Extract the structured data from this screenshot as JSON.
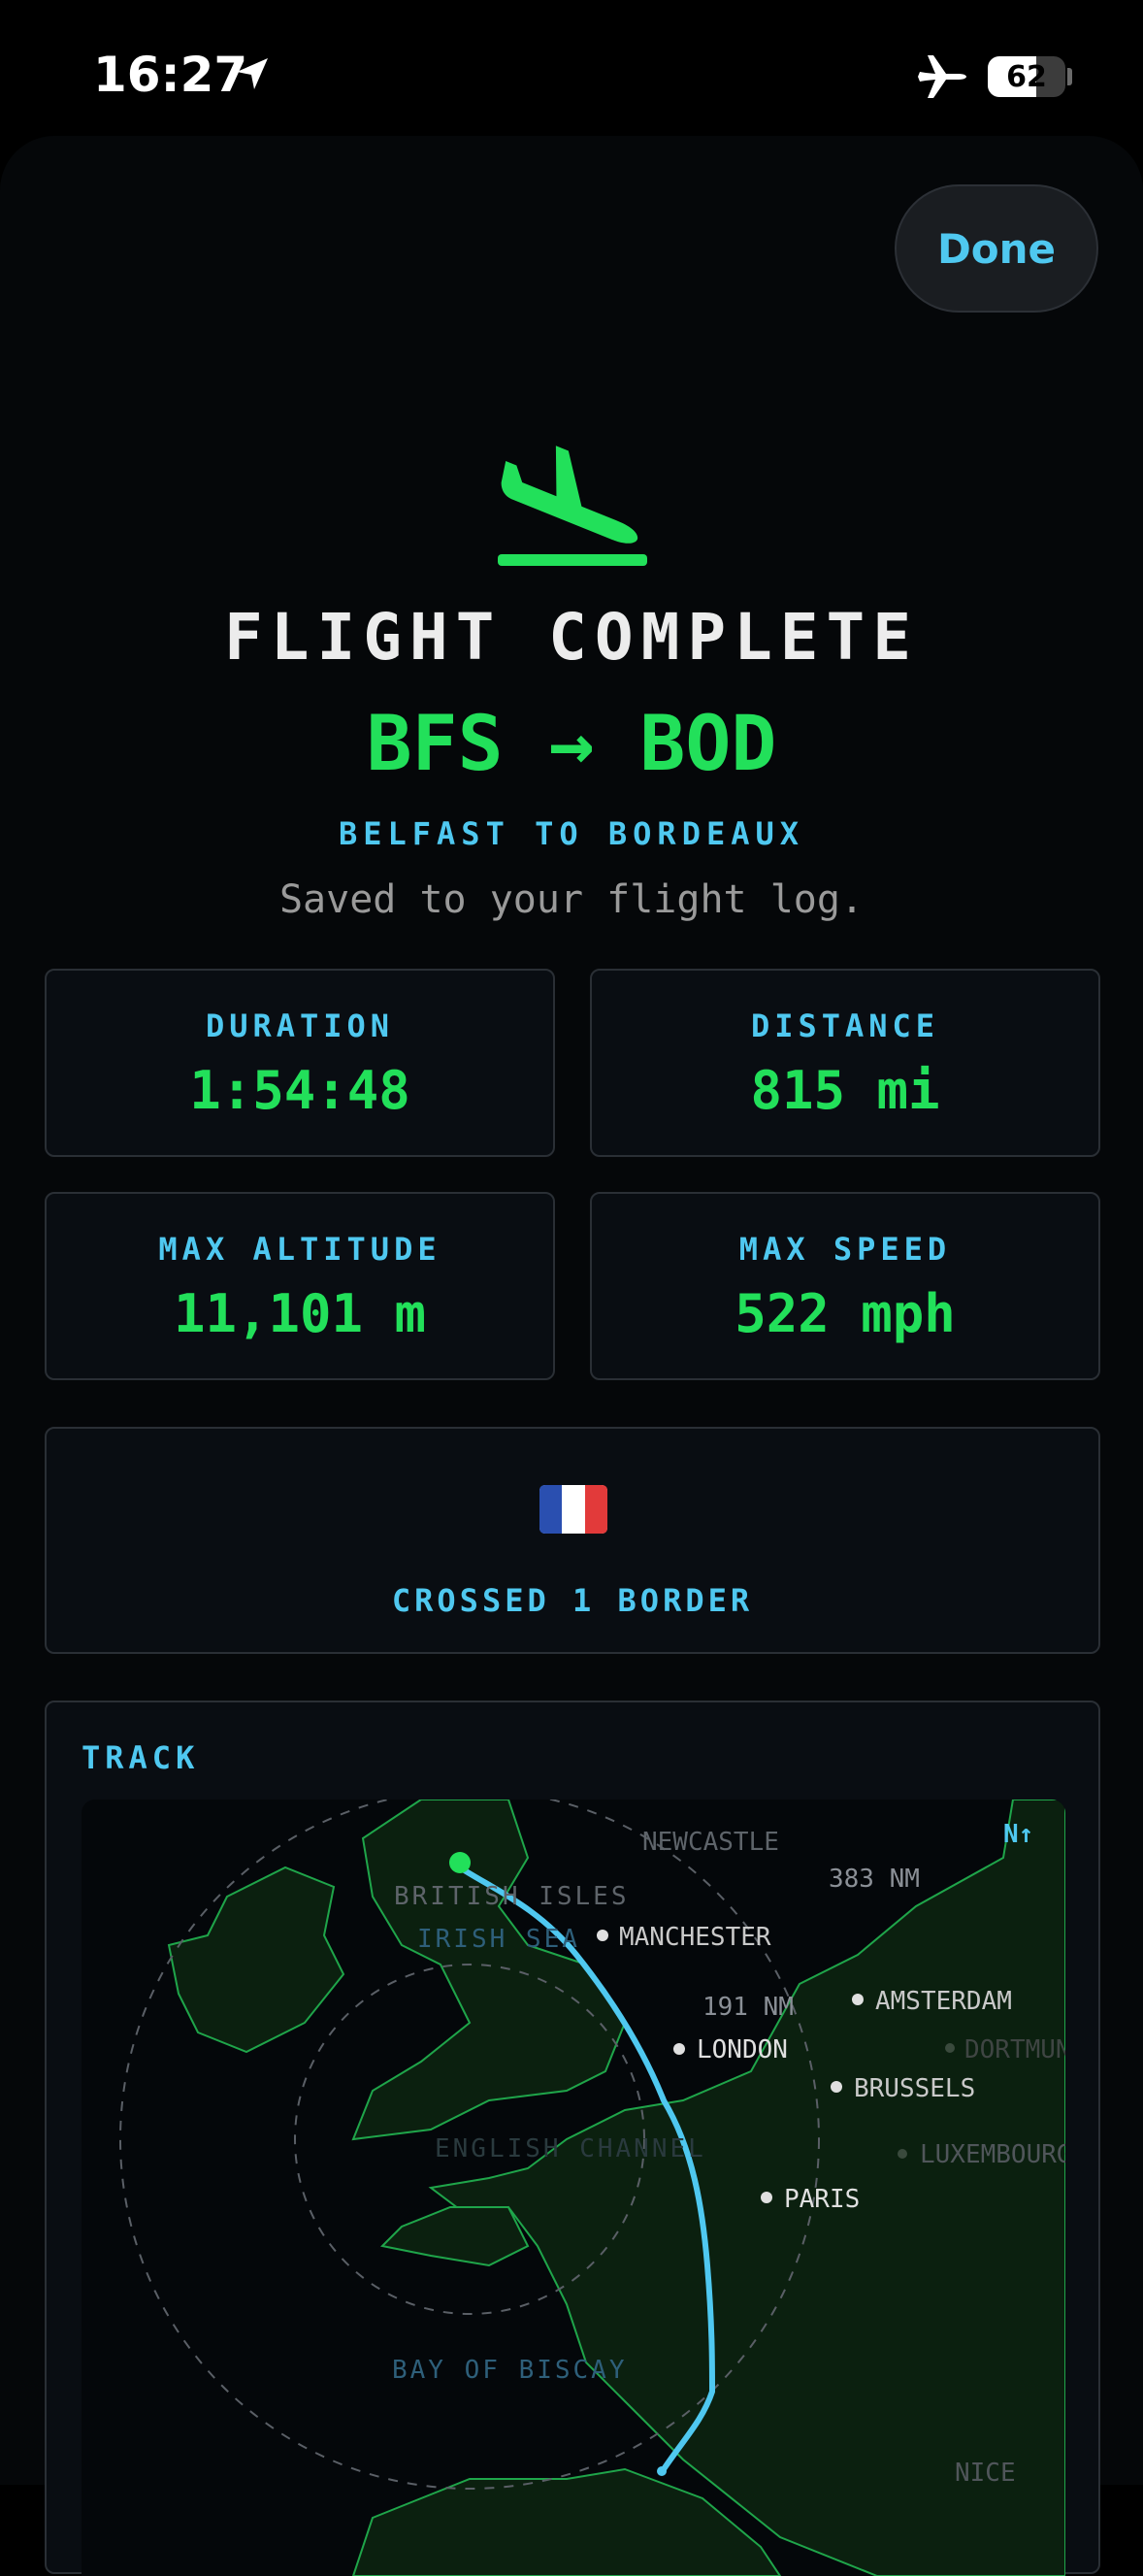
{
  "status_bar": {
    "time": "16:27",
    "battery_level": 62,
    "battery_text": "62",
    "icons": [
      "location-arrow-icon",
      "airplane-mode-icon",
      "battery-icon"
    ]
  },
  "header": {
    "done_label": "Done"
  },
  "hero": {
    "icon": "flight-land-icon",
    "title": "FLIGHT COMPLETE",
    "route_code": "BFS → BOD",
    "route_name": "BELFAST TO BORDEAUX",
    "saved_text": "Saved to your flight log."
  },
  "stats": [
    {
      "label": "DURATION",
      "value": "1:54:48"
    },
    {
      "label": "DISTANCE",
      "value": "815 mi"
    },
    {
      "label": "MAX ALTITUDE",
      "value": "11,101 m"
    },
    {
      "label": "MAX SPEED",
      "value": "522 mph"
    }
  ],
  "borders": {
    "flag": "🇫🇷",
    "text": "CROSSED 1 BORDER"
  },
  "track": {
    "title": "TRACK",
    "north_label": "N↑",
    "ranges": [
      "383 NM",
      "191 NM"
    ],
    "regions": [
      "BRITISH ISLES",
      "IRISH SEA",
      "ENGLISH CHANNEL",
      "BAY OF BISCAY"
    ],
    "cities": [
      "NEWCASTLE",
      "MANCHESTER",
      "LONDON",
      "AMSTERDAM",
      "DORTMUND",
      "BRUSSELS",
      "LUXEMBOURG",
      "PARIS",
      "NICE"
    ],
    "colors": {
      "route": "#4fc8f0",
      "land": "#22e05a",
      "accent": "#4fc8f0"
    }
  }
}
